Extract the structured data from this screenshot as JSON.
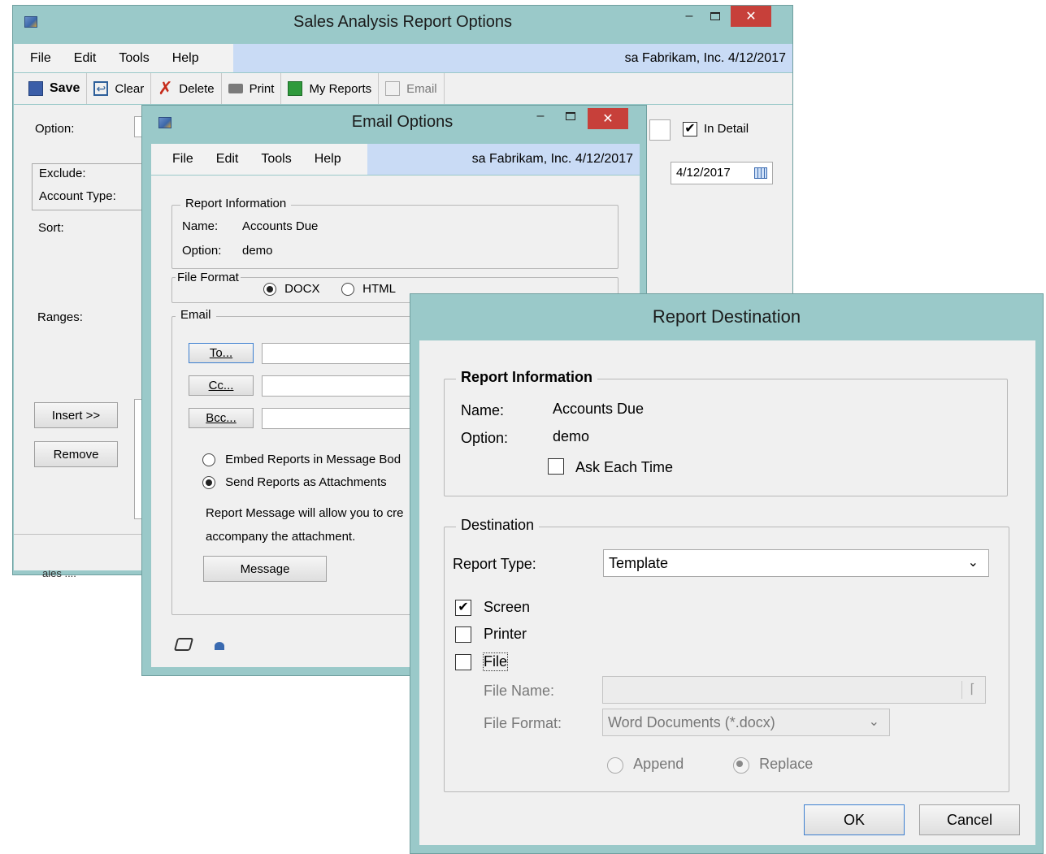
{
  "sales_window": {
    "title": "Sales Analysis Report Options",
    "menu": [
      "File",
      "Edit",
      "Tools",
      "Help"
    ],
    "user_info": "sa  Fabrikam, Inc.  4/12/2017",
    "toolbar": {
      "save": "Save",
      "clear": "Clear",
      "delete": "Delete",
      "print": "Print",
      "my_reports": "My Reports",
      "email": "Email"
    },
    "labels": {
      "option": "Option:",
      "exclude": "Exclude:",
      "account_type": "Account Type:",
      "sort": "Sort:",
      "ranges": "Ranges:",
      "in_detail": "In Detail",
      "date": "4/12/2017"
    },
    "in_detail_checked": true,
    "buttons": {
      "insert": "Insert >>",
      "remove": "Remove"
    },
    "partial_text": "ales ...."
  },
  "email_window": {
    "title": "Email Options",
    "menu": [
      "File",
      "Edit",
      "Tools",
      "Help"
    ],
    "user_info": "sa  Fabrikam, Inc.  4/12/2017",
    "report_info": {
      "group_title": "Report Information",
      "name_label": "Name:",
      "name_value": "Accounts Due",
      "option_label": "Option:",
      "option_value": "demo"
    },
    "file_format": {
      "group_title": "File Format",
      "options": [
        "DOCX",
        "HTML"
      ],
      "selected": "DOCX"
    },
    "email": {
      "group_title": "Email",
      "to": "To...",
      "cc": "Cc...",
      "bcc": "Bcc...",
      "embed": "Embed Reports in Message Bod",
      "attach": "Send Reports as Attachments",
      "selected": "attach",
      "message_line1": "Report Message will allow you to cre",
      "message_line2": "accompany the attachment.",
      "message_button": "Message"
    }
  },
  "destination_window": {
    "title": "Report Destination",
    "report_info": {
      "group_title": "Report Information",
      "name_label": "Name:",
      "name_value": "Accounts Due",
      "option_label": "Option:",
      "option_value": "demo",
      "ask_each_time": "Ask Each Time",
      "ask_each_time_checked": false
    },
    "destination": {
      "group_title": "Destination",
      "report_type_label": "Report Type:",
      "report_type_value": "Template",
      "screen": "Screen",
      "screen_checked": true,
      "printer": "Printer",
      "printer_checked": false,
      "file": "File",
      "file_checked": false,
      "file_name_label": "File Name:",
      "file_name_value": "",
      "file_format_label": "File Format:",
      "file_format_value": "Word Documents (*.docx)",
      "append": "Append",
      "replace": "Replace",
      "selected_mode": "Replace"
    },
    "buttons": {
      "ok": "OK",
      "cancel": "Cancel"
    }
  }
}
